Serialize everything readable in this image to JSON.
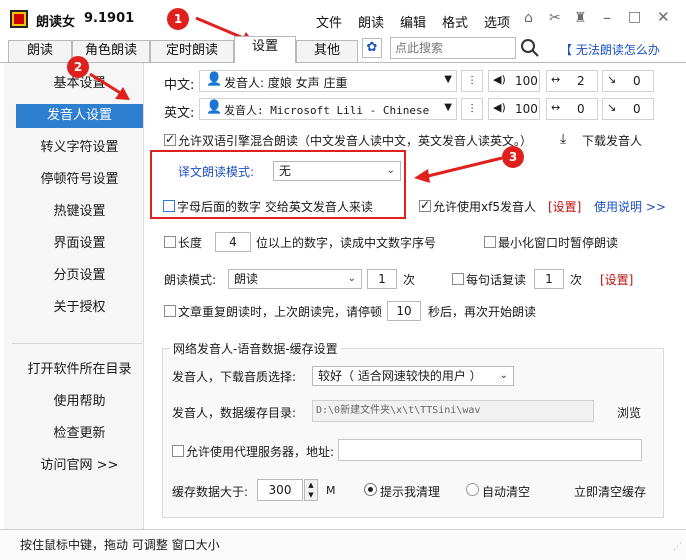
{
  "app": {
    "title": "朗读女",
    "version": "9.1901"
  },
  "menu": [
    "文件",
    "朗读",
    "编辑",
    "格式",
    "选项"
  ],
  "tabs": [
    "朗读",
    "角色朗读",
    "定时朗读",
    "设置",
    "其他"
  ],
  "search": {
    "placeholder": "点此搜索"
  },
  "help_link": "【 无法朗读怎么办",
  "sidebar": {
    "top": [
      "基本设置",
      "发音人设置",
      "转义字符设置",
      "停顿符号设置",
      "热键设置",
      "界面设置",
      "分页设置",
      "关于授权"
    ],
    "bottom": [
      "打开软件所在目录",
      "使用帮助",
      "检查更新",
      "访问官网 >>"
    ]
  },
  "voices": {
    "cn": {
      "label": "中文:",
      "voice": "发音人: 度娘 女声 庄重",
      "volume": "100",
      "speed": "2",
      "pitch": "0"
    },
    "en": {
      "label": "英文:",
      "voice": "发音人: Microsoft Lili - Chinese (C",
      "volume": "100",
      "speed": "0",
      "pitch": "0"
    }
  },
  "options": {
    "mix_engines": "允许双语引擎混合朗读（中文发音人读中文，英文发音人读英文。）",
    "download_voice": "下载发音人",
    "translate_mode_label": "译文朗读模式:",
    "translate_mode_value": "无",
    "digits_after_letters": "字母后面的数字 交给英文发音人来读",
    "allow_xf5": "允许使用xf5发音人",
    "settings_link": "[设置]",
    "usage_link": "使用说明 >>",
    "length_prefix": "长度",
    "length_value": "4",
    "length_suffix": "位以上的数字，读成中文数字序号",
    "minimize_pause": "最小化窗口时暂停朗读",
    "read_mode_label": "朗读模式:",
    "read_mode_value": "朗读",
    "times_value": "1",
    "times_unit": "次",
    "repeat_sentence": "每句话复读",
    "repeat_value": "1",
    "repeat_unit": "次",
    "repeat_settings": "[设置]",
    "article_repeat_a": "文章重复朗读时，上次朗读完，请停顿",
    "article_repeat_value": "10",
    "article_repeat_b": "秒后，再次开始朗读"
  },
  "network": {
    "group_title": "网络发音人-语音数据-缓存设置",
    "quality_label": "发音人，下载音质选择:",
    "quality_value": "较好（ 适合网速较快的用户 ）",
    "cache_dir_label": "发音人，数据缓存目录:",
    "cache_dir_value": "D:\\0新建文件夹\\x\\t\\TTSini\\wav",
    "browse": "浏览",
    "proxy_label": "允许使用代理服务器，地址:",
    "proxy_value": "",
    "cache_size_label": "缓存数据大于:",
    "cache_size_value": "300",
    "cache_unit": "M",
    "remind_clear": "提示我清理",
    "auto_clear": "自动清空",
    "clear_now": "立即清空缓存"
  },
  "annotations": [
    "1",
    "2",
    "3"
  ],
  "status": "按住鼠标中键，拖动 可调整 窗口大小",
  "colors": {
    "accent": "#2f7fd1",
    "annotation_red": "#e0201d",
    "link_red": "#c01010",
    "link_blue": "#1b4fc3"
  }
}
